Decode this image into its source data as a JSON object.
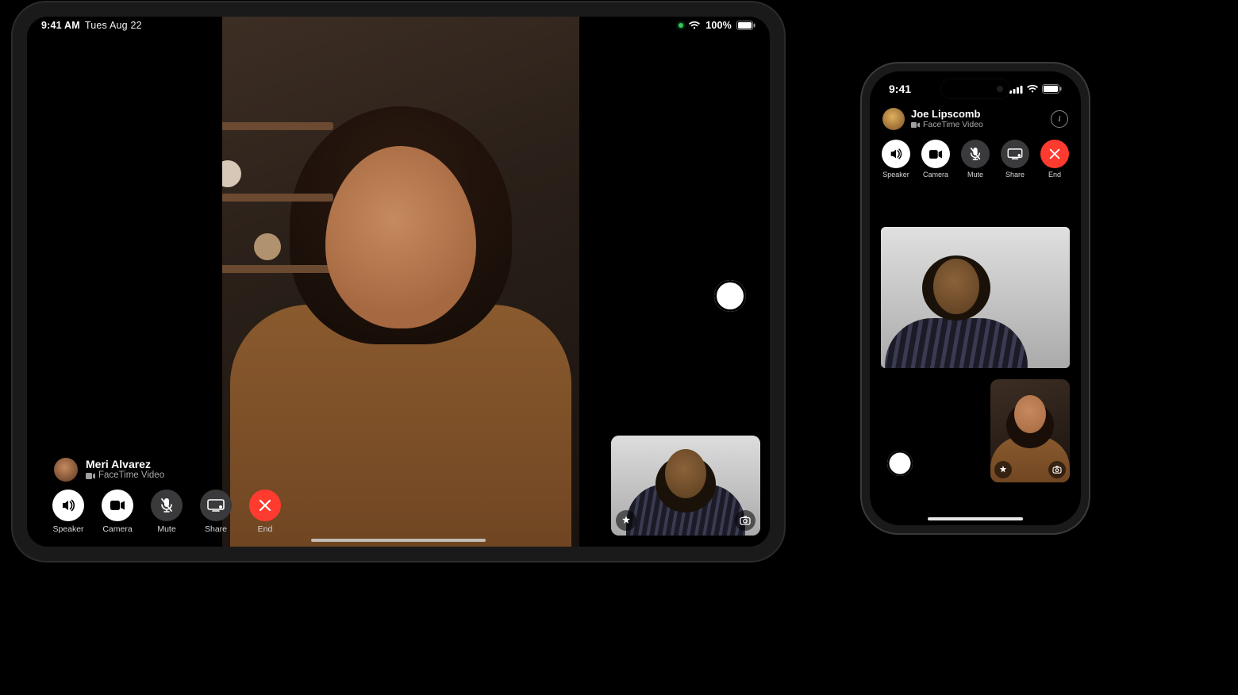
{
  "ipad": {
    "statusbar": {
      "time": "9:41 AM",
      "date": "Tues Aug 22",
      "battery_pct": "100%"
    },
    "caller": {
      "name": "Meri Alvarez",
      "subtitle": "FaceTime Video"
    },
    "controls": {
      "speaker": "Speaker",
      "camera": "Camera",
      "mute": "Mute",
      "share": "Share",
      "end": "End"
    }
  },
  "iphone": {
    "statusbar": {
      "time": "9:41"
    },
    "caller": {
      "name": "Joe Lipscomb",
      "subtitle": "FaceTime Video"
    },
    "controls": {
      "speaker": "Speaker",
      "camera": "Camera",
      "mute": "Mute",
      "share": "Share",
      "end": "End"
    }
  },
  "colors": {
    "end_red": "#ff3b30",
    "control_grey": "#3a3a3c"
  }
}
